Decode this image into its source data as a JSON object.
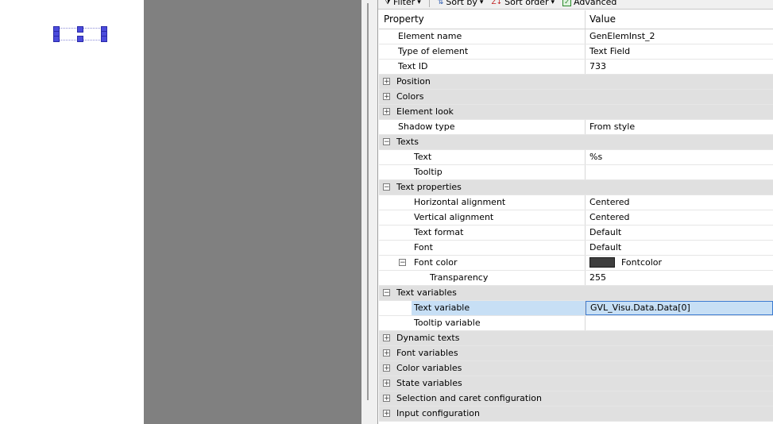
{
  "toolbar": {
    "filter_label": "Filter",
    "sort_by_label": "Sort by",
    "sort_order_label": "Sort order",
    "advanced_label": "Advanced"
  },
  "grid": {
    "header": {
      "property": "Property",
      "value": "Value"
    },
    "rows": [
      {
        "label": "Element name",
        "value": "GenElemInst_2"
      },
      {
        "label": "Type of element",
        "value": "Text Field"
      },
      {
        "label": "Text ID",
        "value": "733"
      },
      {
        "label": "Position",
        "value": ""
      },
      {
        "label": "Colors",
        "value": ""
      },
      {
        "label": "Element look",
        "value": ""
      },
      {
        "label": "Shadow type",
        "value": "From style"
      },
      {
        "label": "Texts",
        "value": ""
      },
      {
        "label": "Text",
        "value": "%s"
      },
      {
        "label": "Tooltip",
        "value": ""
      },
      {
        "label": "Text properties",
        "value": ""
      },
      {
        "label": "Horizontal alignment",
        "value": "Centered"
      },
      {
        "label": "Vertical alignment",
        "value": "Centered"
      },
      {
        "label": "Text format",
        "value": "Default"
      },
      {
        "label": "Font",
        "value": "Default"
      },
      {
        "label": "Font color",
        "value": "Fontcolor"
      },
      {
        "label": "Transparency",
        "value": "255"
      },
      {
        "label": "Text variables",
        "value": ""
      },
      {
        "label": "Text variable",
        "value": "GVL_Visu.Data.Data[0]"
      },
      {
        "label": "Tooltip variable",
        "value": ""
      },
      {
        "label": "Dynamic texts",
        "value": ""
      },
      {
        "label": "Font variables",
        "value": ""
      },
      {
        "label": "Color variables",
        "value": ""
      },
      {
        "label": "State variables",
        "value": ""
      },
      {
        "label": "Selection and caret configuration",
        "value": ""
      },
      {
        "label": "Input configuration",
        "value": ""
      }
    ]
  },
  "colors": {
    "font_color_swatch": "#3e3e3e",
    "selection": "#c7dff5",
    "category_bg": "#e0e0e0"
  },
  "icons": {
    "expand": "+",
    "collapse": "−"
  }
}
